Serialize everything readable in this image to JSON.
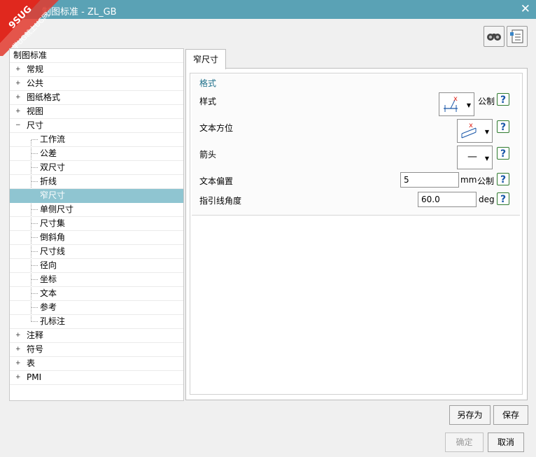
{
  "window": {
    "title": "制图标准 - ZL_GB",
    "close_icon": "close-icon"
  },
  "watermark": {
    "line1": "9SUG",
    "line2": "学UG就上UG网"
  },
  "toolbar": {
    "icons": [
      "find-binoculars-icon",
      "list-settings-icon"
    ]
  },
  "tree": {
    "root": "制图标准",
    "items": [
      {
        "label": "常规",
        "expander": "+"
      },
      {
        "label": "公共",
        "expander": "+"
      },
      {
        "label": "图纸格式",
        "expander": "+"
      },
      {
        "label": "视图",
        "expander": "+"
      },
      {
        "label": "尺寸",
        "expander": "−"
      },
      {
        "label": "工作流"
      },
      {
        "label": "公差"
      },
      {
        "label": "双尺寸"
      },
      {
        "label": "折线"
      },
      {
        "label": "窄尺寸",
        "selected": true
      },
      {
        "label": "单侧尺寸"
      },
      {
        "label": "尺寸集"
      },
      {
        "label": "倒斜角"
      },
      {
        "label": "尺寸线"
      },
      {
        "label": "径向"
      },
      {
        "label": "坐标"
      },
      {
        "label": "文本"
      },
      {
        "label": "参考"
      },
      {
        "label": "孔标注"
      },
      {
        "label": "注释",
        "expander": "+"
      },
      {
        "label": "符号",
        "expander": "+"
      },
      {
        "label": "表",
        "expander": "+"
      },
      {
        "label": "PMI",
        "expander": "+"
      }
    ]
  },
  "tab": {
    "label": "窄尺寸"
  },
  "group": {
    "title": "格式"
  },
  "props": {
    "style_label": "样式",
    "style_unit": "公制",
    "text_orient_label": "文本方位",
    "arrow_label": "箭头",
    "arrow_value": "—",
    "text_offset_label": "文本偏置",
    "text_offset_value": "5",
    "text_offset_unit": "mm",
    "text_offset_unit2": "公制",
    "leader_angle_label": "指引线角度",
    "leader_angle_value": "60.0",
    "leader_angle_unit": "deg",
    "help_glyph": "?"
  },
  "buttons": {
    "save_as": "另存为",
    "save": "保存",
    "ok": "确定",
    "cancel": "取消"
  },
  "colors": {
    "titlebar": "#5aa2b5",
    "selection": "#8fc5d1",
    "group_title": "#1d6f8a"
  }
}
